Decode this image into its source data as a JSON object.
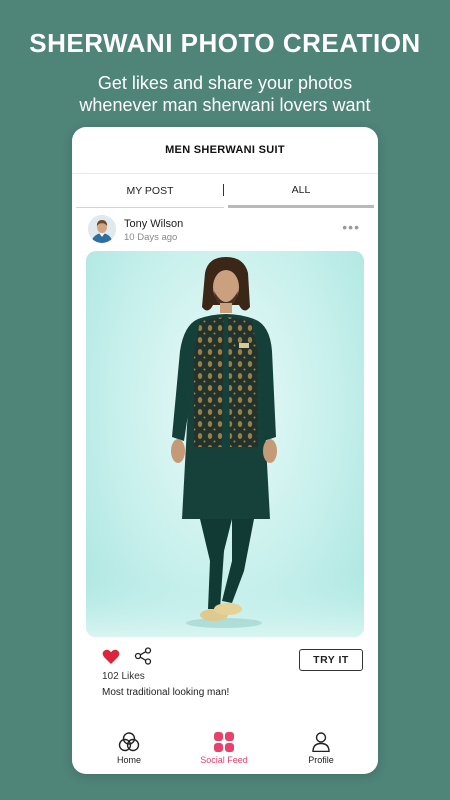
{
  "promo": {
    "title": "SHERWANI PHOTO CREATION",
    "subtitle_line1": "Get likes and share your photos",
    "subtitle_line2": "whenever man sherwani lovers want"
  },
  "app": {
    "header_title": "MEN SHERWANI SUIT",
    "tabs": [
      {
        "label": "MY POST"
      },
      {
        "label": "ALL",
        "active": true
      }
    ]
  },
  "post": {
    "user_name": "Tony Wilson",
    "time": "10 Days ago",
    "likes_text": "102 Likes",
    "caption": "Most traditional looking man!",
    "try_label": "TRY IT",
    "liked": true
  },
  "nav": {
    "items": [
      {
        "label": "Home",
        "icon": "home-circles-icon"
      },
      {
        "label": "Social Feed",
        "icon": "grid-icon",
        "active": true
      },
      {
        "label": "Profile",
        "icon": "user-icon"
      }
    ]
  },
  "colors": {
    "background": "#4f8479",
    "accent": "#e8416b",
    "heart": "#d9263a"
  }
}
